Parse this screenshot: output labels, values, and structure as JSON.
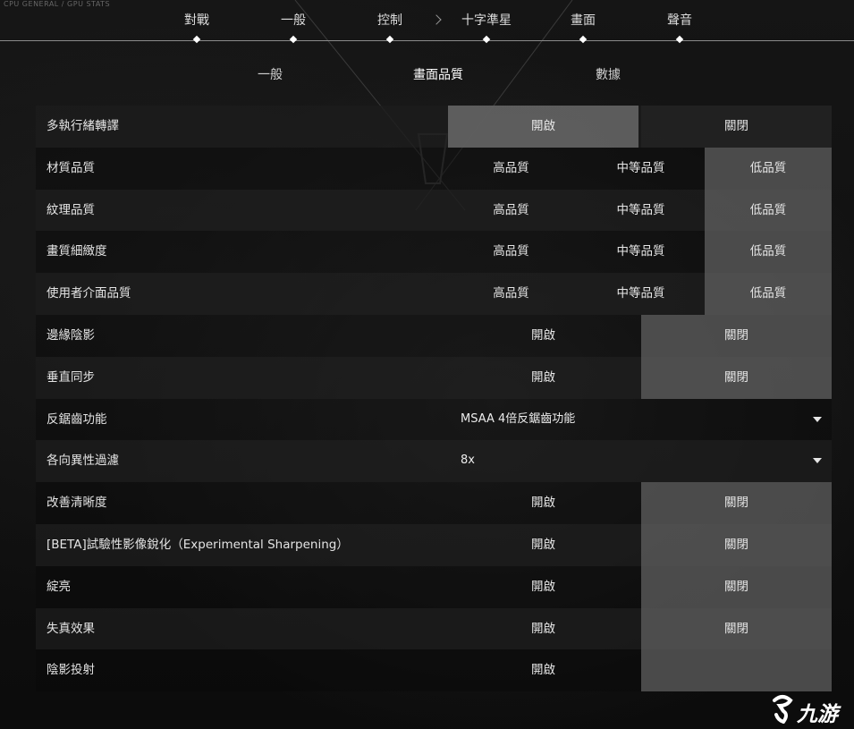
{
  "corner_text": "CPU GENERAL / GPU STATS",
  "top_nav": {
    "items": [
      {
        "label": "對戰"
      },
      {
        "label": "一般"
      },
      {
        "label": "控制"
      },
      {
        "label": "十字準星"
      },
      {
        "label": "畫面"
      },
      {
        "label": "聲音"
      }
    ],
    "active": "畫面"
  },
  "sub_tabs": {
    "items": [
      {
        "label": "一般"
      },
      {
        "label": "畫面品質"
      },
      {
        "label": "數據"
      }
    ],
    "active": "畫面品質"
  },
  "settings": [
    {
      "label": "多執行緒轉譯",
      "type": "toggle",
      "on": "開啟",
      "off": "關閉",
      "selected": "開啟"
    },
    {
      "label": "材質品質",
      "type": "quality",
      "high": "高品質",
      "mid": "中等品質",
      "low": "低品質",
      "selected": "低品質"
    },
    {
      "label": "紋理品質",
      "type": "quality",
      "high": "高品質",
      "mid": "中等品質",
      "low": "低品質",
      "selected": "低品質"
    },
    {
      "label": "畫質細緻度",
      "type": "quality",
      "high": "高品質",
      "mid": "中等品質",
      "low": "低品質",
      "selected": "低品質"
    },
    {
      "label": "使用者介面品質",
      "type": "quality",
      "high": "高品質",
      "mid": "中等品質",
      "low": "低品質",
      "selected": "低品質"
    },
    {
      "label": "邊緣陰影",
      "type": "toggle",
      "on": "開啟",
      "off": "關閉",
      "selected": "關閉"
    },
    {
      "label": "垂直同步",
      "type": "toggle",
      "on": "開啟",
      "off": "關閉",
      "selected": "關閉"
    },
    {
      "label": "反鋸齒功能",
      "type": "dropdown",
      "value": "MSAA 4倍反鋸齒功能"
    },
    {
      "label": "各向異性過濾",
      "type": "dropdown",
      "value": "8x"
    },
    {
      "label": "改善清晰度",
      "type": "toggle",
      "on": "開啟",
      "off": "關閉",
      "selected": "關閉"
    },
    {
      "label": "[BETA]試驗性影像銳化（Experimental Sharpening）",
      "type": "toggle",
      "on": "開啟",
      "off": "關閉",
      "selected": "關閉"
    },
    {
      "label": "綻亮",
      "type": "toggle",
      "on": "開啟",
      "off": "關閉",
      "selected": "關閉"
    },
    {
      "label": "失真效果",
      "type": "toggle",
      "on": "開啟",
      "off": "關閉",
      "selected": "關閉"
    },
    {
      "label": "陰影投射",
      "type": "toggle",
      "on": "開啟",
      "off": "",
      "selected": "off"
    }
  ],
  "watermark": {
    "text": "九游",
    "icon": "jiuyou-logo-icon"
  },
  "colors": {
    "selected": "#5c5c5c",
    "row_dark": "#1c1c1c",
    "text": "#e6e6e6"
  }
}
